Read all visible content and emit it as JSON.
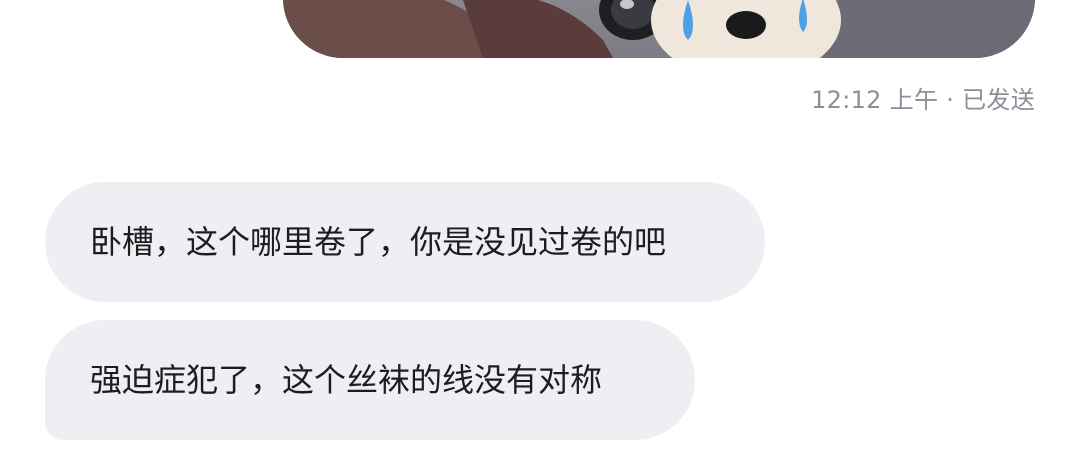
{
  "conversation": {
    "sent": {
      "image_alt": "sticker image of a crying puppy holding a camera",
      "time": "12:12 上午",
      "separator": "·",
      "status": "已发送"
    },
    "received": [
      {
        "text": "卧槽，这个哪里卷了，你是没见过卷的吧"
      },
      {
        "text": "强迫症犯了，这个丝袜的线没有对称"
      }
    ]
  },
  "colors": {
    "received_bubble": "#eeeff2",
    "meta_text": "#8a8f98",
    "message_text": "#1d1d1f"
  }
}
